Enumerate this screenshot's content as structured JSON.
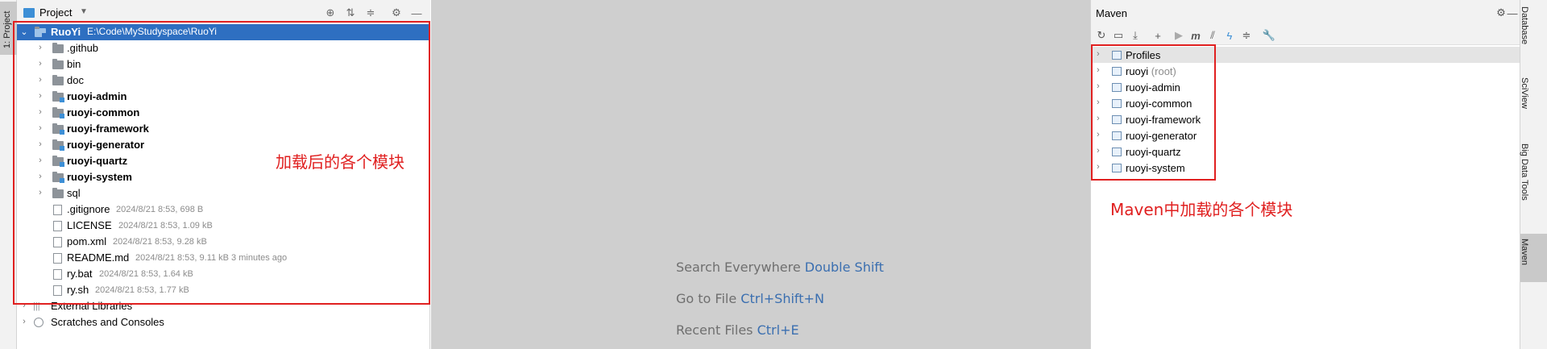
{
  "left_strip": {
    "tab_label": "1: Project"
  },
  "project": {
    "title": "Project",
    "header_icons": [
      "target-icon",
      "expand-all-icon",
      "collapse-all-icon",
      "gear-icon",
      "minimize-icon"
    ],
    "root": {
      "name": "RuoYi",
      "path": "E:\\Code\\MyStudyspace\\RuoYi"
    },
    "items": [
      {
        "label": ".github",
        "type": "folder",
        "bold": false
      },
      {
        "label": "bin",
        "type": "folder",
        "bold": false
      },
      {
        "label": "doc",
        "type": "folder",
        "bold": false
      },
      {
        "label": "ruoyi-admin",
        "type": "module",
        "bold": true
      },
      {
        "label": "ruoyi-common",
        "type": "module",
        "bold": true
      },
      {
        "label": "ruoyi-framework",
        "type": "module",
        "bold": true
      },
      {
        "label": "ruoyi-generator",
        "type": "module",
        "bold": true
      },
      {
        "label": "ruoyi-quartz",
        "type": "module",
        "bold": true
      },
      {
        "label": "ruoyi-system",
        "type": "module",
        "bold": true
      },
      {
        "label": "sql",
        "type": "folder",
        "bold": false
      }
    ],
    "files": [
      {
        "label": ".gitignore",
        "meta": "2024/8/21 8:53, 698 B"
      },
      {
        "label": "LICENSE",
        "meta": "2024/8/21 8:53, 1.09 kB"
      },
      {
        "label": "pom.xml",
        "meta": "2024/8/21 8:53, 9.28 kB"
      },
      {
        "label": "README.md",
        "meta": "2024/8/21 8:53, 9.11 kB 3 minutes ago"
      },
      {
        "label": "ry.bat",
        "meta": "2024/8/21 8:53, 1.64 kB"
      },
      {
        "label": "ry.sh",
        "meta": "2024/8/21 8:53, 1.77 kB"
      }
    ],
    "external_libraries": "External Libraries",
    "scratches": "Scratches and Consoles"
  },
  "annotation_project": "加载后的各个模块",
  "editor_hints": [
    {
      "text": "Search Everywhere",
      "key": "Double Shift"
    },
    {
      "text": "Go to File",
      "key": "Ctrl+Shift+N"
    },
    {
      "text": "Recent Files",
      "key": "Ctrl+E"
    }
  ],
  "maven": {
    "title": "Maven",
    "toolbar_icons": [
      "reload-icon",
      "add-folder-icon",
      "download-icon",
      "plus-icon",
      "run-icon",
      "maven-goal-icon",
      "toggle-offline-icon",
      "lightning-icon",
      "collapse-icon",
      "wrench-icon"
    ],
    "items": [
      {
        "label": "Profiles",
        "suffix": ""
      },
      {
        "label": "ruoyi",
        "suffix": " (root)"
      },
      {
        "label": "ruoyi-admin",
        "suffix": ""
      },
      {
        "label": "ruoyi-common",
        "suffix": ""
      },
      {
        "label": "ruoyi-framework",
        "suffix": ""
      },
      {
        "label": "ruoyi-generator",
        "suffix": ""
      },
      {
        "label": "ruoyi-quartz",
        "suffix": ""
      },
      {
        "label": "ruoyi-system",
        "suffix": ""
      }
    ]
  },
  "annotation_maven": "Maven中加载的各个模块",
  "right_strip": {
    "tabs": [
      "Database",
      "SciView",
      "Big Data Tools",
      "Maven"
    ]
  },
  "colors": {
    "selection": "#2e6fc1",
    "annotation": "#e02020",
    "link_key": "#3b6fb0"
  }
}
